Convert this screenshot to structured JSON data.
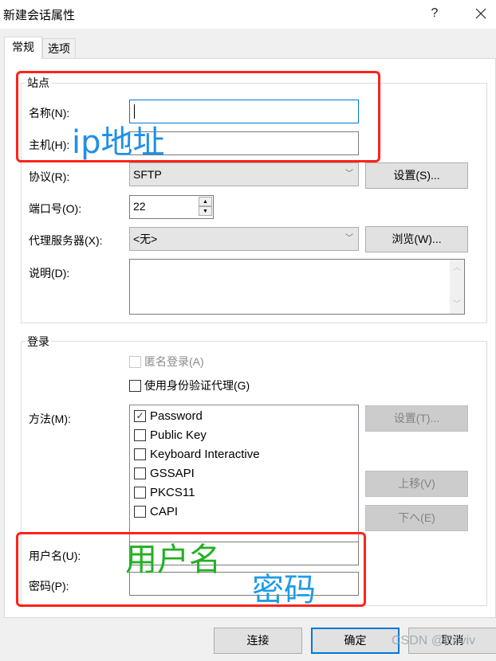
{
  "window": {
    "title": "新建会话属性",
    "help_label": "?",
    "close_label": "✕"
  },
  "tabs": [
    {
      "label": "常规",
      "active": true
    },
    {
      "label": "选项",
      "active": false
    }
  ],
  "site_group": {
    "legend": "站点",
    "name_label": "名称(N):",
    "name_value": "",
    "host_label": "主机(H):",
    "host_value": "",
    "protocol_label": "协议(R):",
    "protocol_value": "SFTP",
    "protocol_settings_button": "设置(S)...",
    "port_label": "端口号(O):",
    "port_value": "22",
    "proxy_label": "代理服务器(X):",
    "proxy_value": "<无>",
    "proxy_browse_button": "浏览(W)...",
    "description_label": "说明(D):",
    "description_value": ""
  },
  "login_group": {
    "legend": "登录",
    "anonymous_label": "匿名登录(A)",
    "anonymous_checked": false,
    "anonymous_disabled": true,
    "agent_label": "使用身份验证代理(G)",
    "agent_checked": false,
    "method_label": "方法(M):",
    "methods": [
      {
        "label": "Password",
        "checked": true
      },
      {
        "label": "Public Key",
        "checked": false
      },
      {
        "label": "Keyboard Interactive",
        "checked": false
      },
      {
        "label": "GSSAPI",
        "checked": false
      },
      {
        "label": "PKCS11",
        "checked": false
      },
      {
        "label": "CAPI",
        "checked": false
      }
    ],
    "method_settings_button": "设置(T)...",
    "move_up_button": "上移(V)",
    "move_down_button": "下へ(E)",
    "username_label": "用户名(U):",
    "username_value": "",
    "password_label": "密码(P):",
    "password_value": ""
  },
  "footer": {
    "connect_button": "连接",
    "ok_button": "确定",
    "cancel_button": "取消"
  },
  "annotations": {
    "host_note": "ip地址",
    "username_note": "用户名",
    "password_note": "密码",
    "highlight_color": "#ff2218",
    "host_note_color": "#1e90e8",
    "username_note_color": "#22b022",
    "password_note_color": "#1e9be8"
  },
  "watermark": "CSDN @Edviv",
  "icons": {
    "check_mark": "✓",
    "dropdown_arrow": "﹀",
    "spin_up": "▲",
    "spin_down": "▼",
    "scroll_up": "︿",
    "scroll_down": "﹀"
  }
}
